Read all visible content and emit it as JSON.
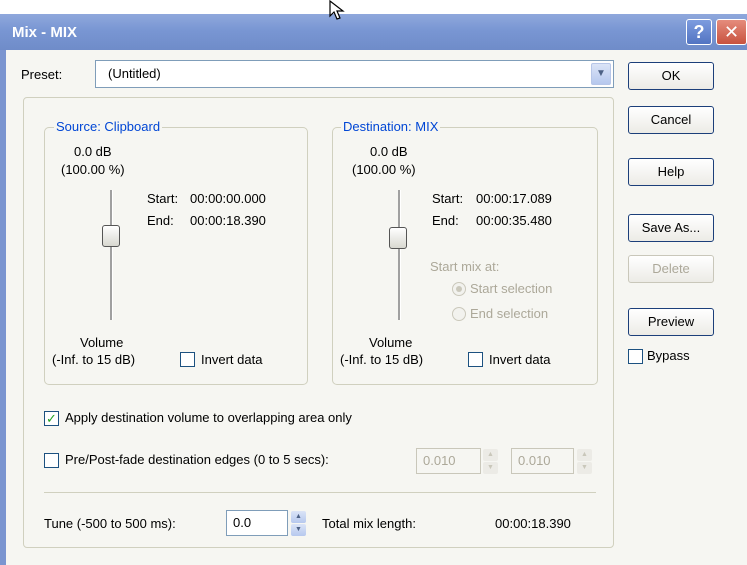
{
  "window": {
    "title": "Mix - MIX"
  },
  "titlebar": {
    "help_icon_glyph": "?",
    "close_icon_glyph": "✕"
  },
  "preset": {
    "label": "Preset:",
    "value": "(Untitled)"
  },
  "buttons": {
    "ok": "OK",
    "cancel": "Cancel",
    "help": "Help",
    "save_as": "Save As...",
    "delete": "Delete",
    "preview": "Preview"
  },
  "bypass": {
    "label": "Bypass",
    "checked": false
  },
  "source": {
    "title": "Source: Clipboard",
    "db": "0.0 dB",
    "percent": "(100.00 %)",
    "start_label": "Start:",
    "start": "00:00:00.000",
    "end_label": "End:",
    "end": "00:00:18.390",
    "volume_label": "Volume",
    "range_label": "(-Inf. to 15 dB)",
    "invert_label": "Invert data",
    "invert_checked": false
  },
  "destination": {
    "title": "Destination: MIX",
    "db": "0.0 dB",
    "percent": "(100.00 %)",
    "start_label": "Start:",
    "start": "00:00:17.089",
    "end_label": "End:",
    "end": "00:00:35.480",
    "start_mix_label": "Start mix at:",
    "radio_start": "Start selection",
    "radio_end": "End selection",
    "volume_label": "Volume",
    "range_label": "(-Inf. to 15 dB)",
    "invert_label": "Invert data",
    "invert_checked": false
  },
  "options": {
    "apply_dest_label": "Apply destination volume to overlapping area only",
    "apply_dest_checked": true,
    "prepost_label": "Pre/Post-fade destination edges (0 to 5 secs):",
    "prepost_checked": false,
    "fade_in": "0.010",
    "fade_out": "0.010"
  },
  "tune": {
    "label": "Tune (-500 to 500 ms):",
    "value": "0.0"
  },
  "total": {
    "label": "Total mix length:",
    "value": "00:00:18.390"
  }
}
